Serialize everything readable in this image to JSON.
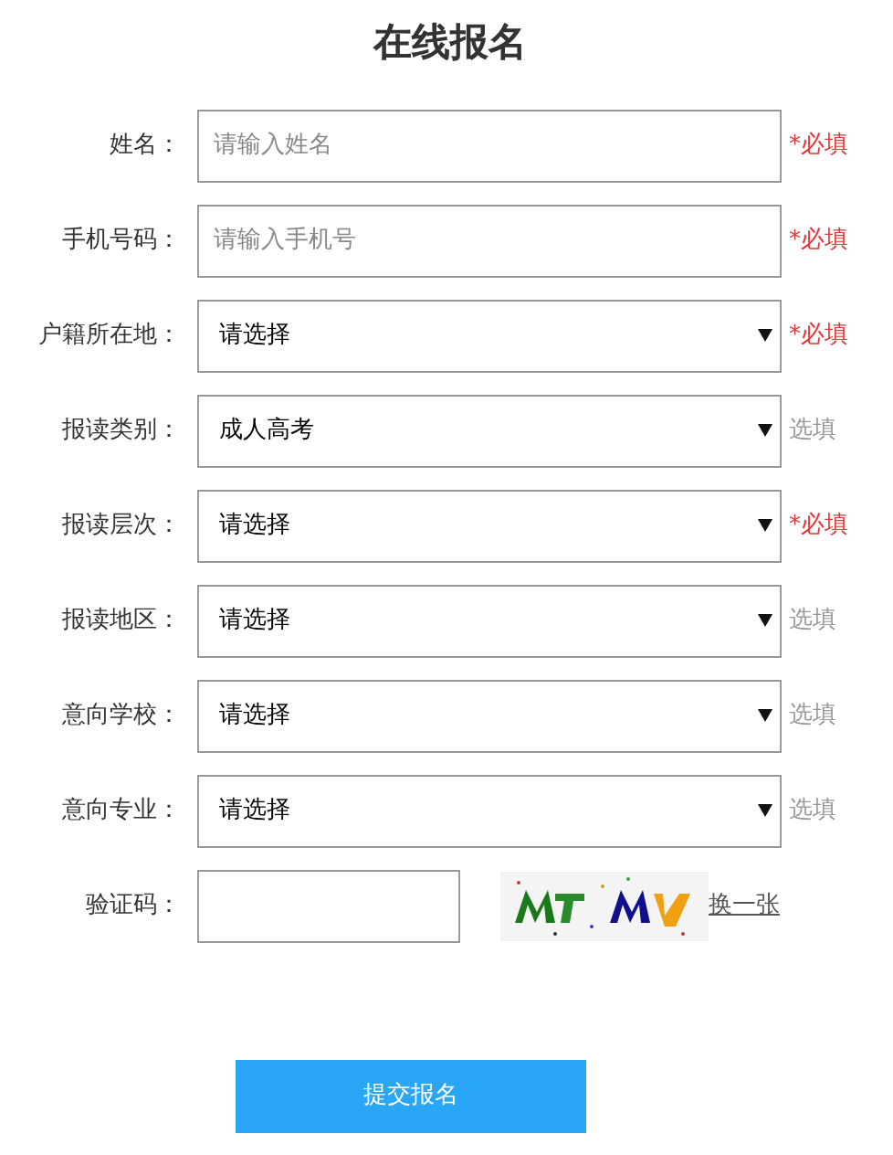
{
  "title": "在线报名",
  "fields": [
    {
      "kind": "text",
      "label": "姓名：",
      "placeholder": "请输入姓名",
      "hint": {
        "text": "*必填",
        "required": true
      }
    },
    {
      "kind": "text",
      "label": "手机号码：",
      "placeholder": "请输入手机号",
      "hint": {
        "text": "*必填",
        "required": true
      }
    },
    {
      "kind": "select",
      "label": "户籍所在地：",
      "value": "请选择",
      "hint": {
        "text": "*必填",
        "required": true
      }
    },
    {
      "kind": "select",
      "label": "报读类别：",
      "value": "成人高考",
      "hint": {
        "text": "选填",
        "required": false
      }
    },
    {
      "kind": "select",
      "label": "报读层次：",
      "value": "请选择",
      "hint": {
        "text": "*必填",
        "required": true
      }
    },
    {
      "kind": "select",
      "label": "报读地区：",
      "value": "请选择",
      "hint": {
        "text": "选填",
        "required": false
      }
    },
    {
      "kind": "select",
      "label": "意向学校：",
      "value": "请选择",
      "hint": {
        "text": "选填",
        "required": false
      }
    },
    {
      "kind": "select",
      "label": "意向专业：",
      "value": "请选择",
      "hint": {
        "text": "选填",
        "required": false
      }
    },
    {
      "kind": "captcha",
      "label": "验证码：",
      "refresh_link": "换一张"
    }
  ],
  "submit_button": "提交报名"
}
